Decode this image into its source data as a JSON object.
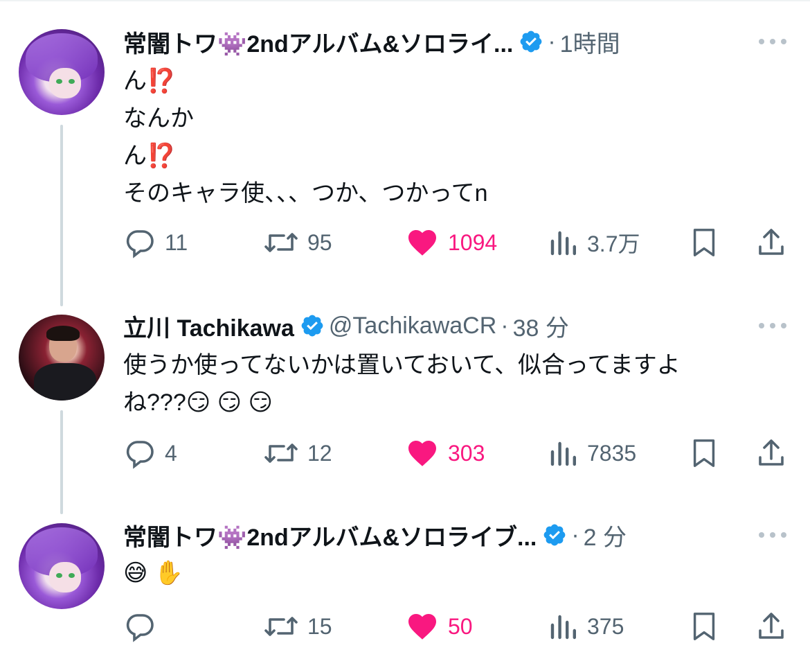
{
  "tweets": [
    {
      "name": "常闇トワ👾2ndアルバム&ソロライ...",
      "handle": "",
      "time": "1時間",
      "lines": [
        "ん⁉️",
        "なんか",
        "ん⁉️",
        "そのキャラ使、、、つか、つかってn"
      ],
      "replies": "11",
      "retweets": "95",
      "likes": "1094",
      "views": "3.7万"
    },
    {
      "name": "立川 Tachikawa",
      "handle": "@TachikawaCR",
      "time": "38 分",
      "lines": [
        "使うか使ってないかは置いておいて、似合ってますよ",
        "ね???😏 😏 😏"
      ],
      "replies": "4",
      "retweets": "12",
      "likes": "303",
      "views": "7835"
    },
    {
      "name": "常闇トワ👾2ndアルバム&ソロライブ...",
      "handle": "",
      "time": "2 分",
      "lines": [
        "😅 ✋"
      ],
      "replies": "",
      "retweets": "15",
      "likes": "50",
      "views": "375"
    }
  ],
  "colors": {
    "like": "#f91880",
    "verified": "#1d9bf0",
    "muted": "#536471",
    "thread": "#cfd9de"
  },
  "icons": [
    "reply-icon",
    "retweet-icon",
    "like-icon",
    "views-icon",
    "bookmark-icon",
    "share-icon",
    "verified-icon",
    "more-icon"
  ]
}
